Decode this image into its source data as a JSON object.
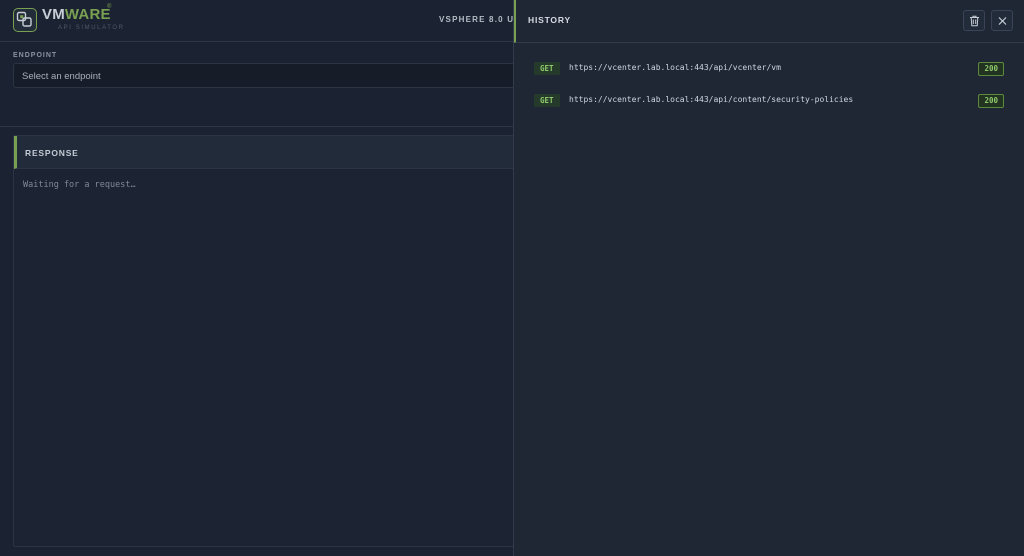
{
  "header": {
    "brand_prefix": "VM",
    "brand_accent": "WARE",
    "registered": "®",
    "subtitle": "API SIMULATOR",
    "version": "VSPHERE 8.0 U"
  },
  "endpoint": {
    "label": "ENDPOINT",
    "placeholder": "Select an endpoint"
  },
  "response": {
    "title": "RESPONSE",
    "body": "Waiting for a request…"
  },
  "history": {
    "title": "HISTORY",
    "entries": [
      {
        "method": "GET",
        "url": "https://vcenter.lab.local:443/api/vcenter/vm",
        "status": "200"
      },
      {
        "method": "GET",
        "url": "https://vcenter.lab.local:443/api/content/security-policies",
        "status": "200"
      }
    ]
  },
  "icons": {
    "logo": "vmware-logo-icon",
    "trash": "trash-icon",
    "close": "close-icon"
  },
  "colors": {
    "accent": "#7aa052",
    "background": "#1b2231",
    "success": "#8fcb6c"
  }
}
